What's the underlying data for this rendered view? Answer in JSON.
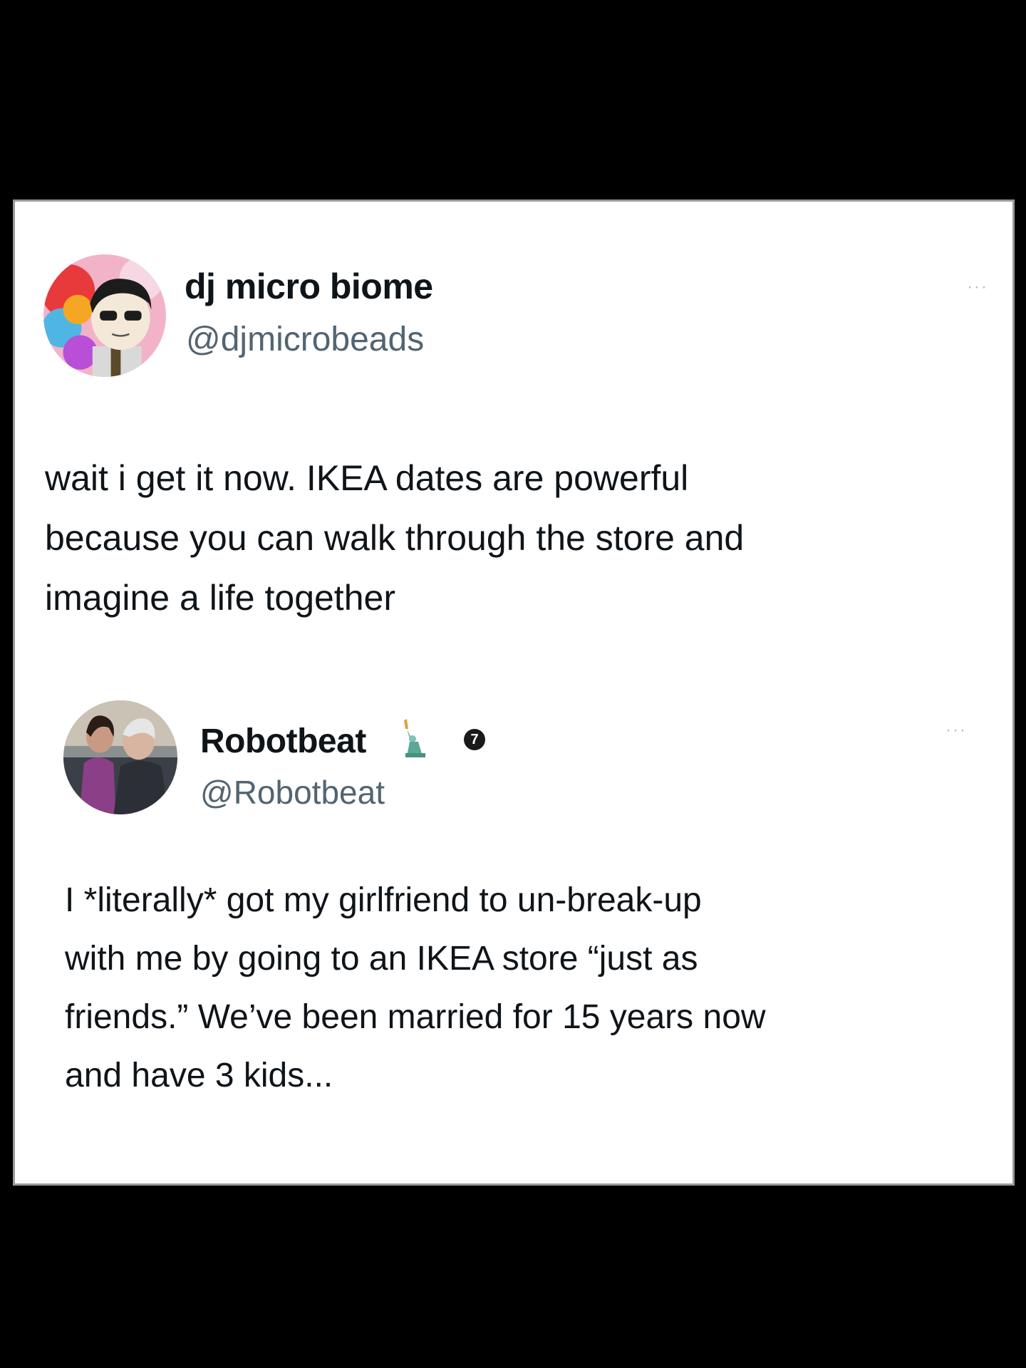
{
  "post1": {
    "display_name": "dj micro biome",
    "handle": "@djmicrobeads",
    "more_label": "···",
    "text": "wait i get it now. IKEA dates are powerful\nbecause you can walk through the store and\nimagine a life together",
    "avatar_icon": "cartoon-avatar-icon"
  },
  "post2": {
    "display_name": "Robotbeat",
    "handle": "@Robotbeat",
    "badge": "7",
    "more_label": "···",
    "text": "I *literally* got my girlfriend to un-break-up\nwith me by going to an IKEA store “just as\nfriends.” We’ve been married for 15 years now\nand have 3 kids...",
    "avatar_icon": "photo-avatar-icon",
    "emoji_icon": "statue-of-liberty-icon"
  },
  "colors": {
    "background": "#000000",
    "card": "#ffffff",
    "text": "#0f1419",
    "handle": "#536471"
  }
}
